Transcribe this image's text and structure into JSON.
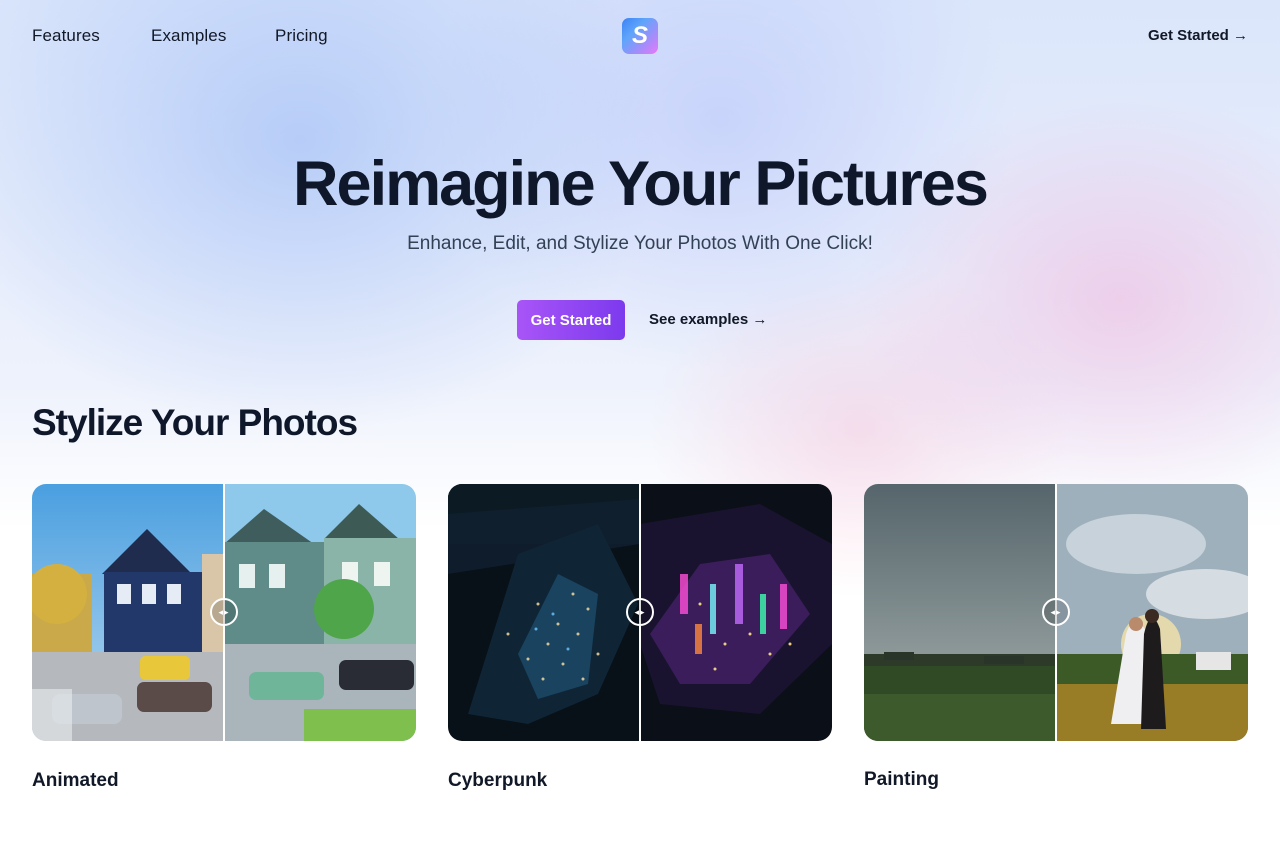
{
  "nav": {
    "links": [
      "Features",
      "Examples",
      "Pricing"
    ],
    "logo_letter": "S",
    "cta": "Get Started →"
  },
  "hero": {
    "title": "Reimagine Your Pictures",
    "subtitle": "Enhance, Edit, and Stylize Your Photos With One Click!",
    "primary_button": "Get Started",
    "secondary_link": "See examples →"
  },
  "section": {
    "title": "Stylize Your Photos",
    "cards": [
      {
        "label": "Animated",
        "slider_position": 0.5
      },
      {
        "label": "Cyberpunk",
        "slider_position": 0.5
      },
      {
        "label": "Painting",
        "slider_position": 0.5
      }
    ]
  },
  "colors": {
    "accent_start": "#a855f7",
    "accent_end": "#7c3aed",
    "text": "#0f172a"
  }
}
